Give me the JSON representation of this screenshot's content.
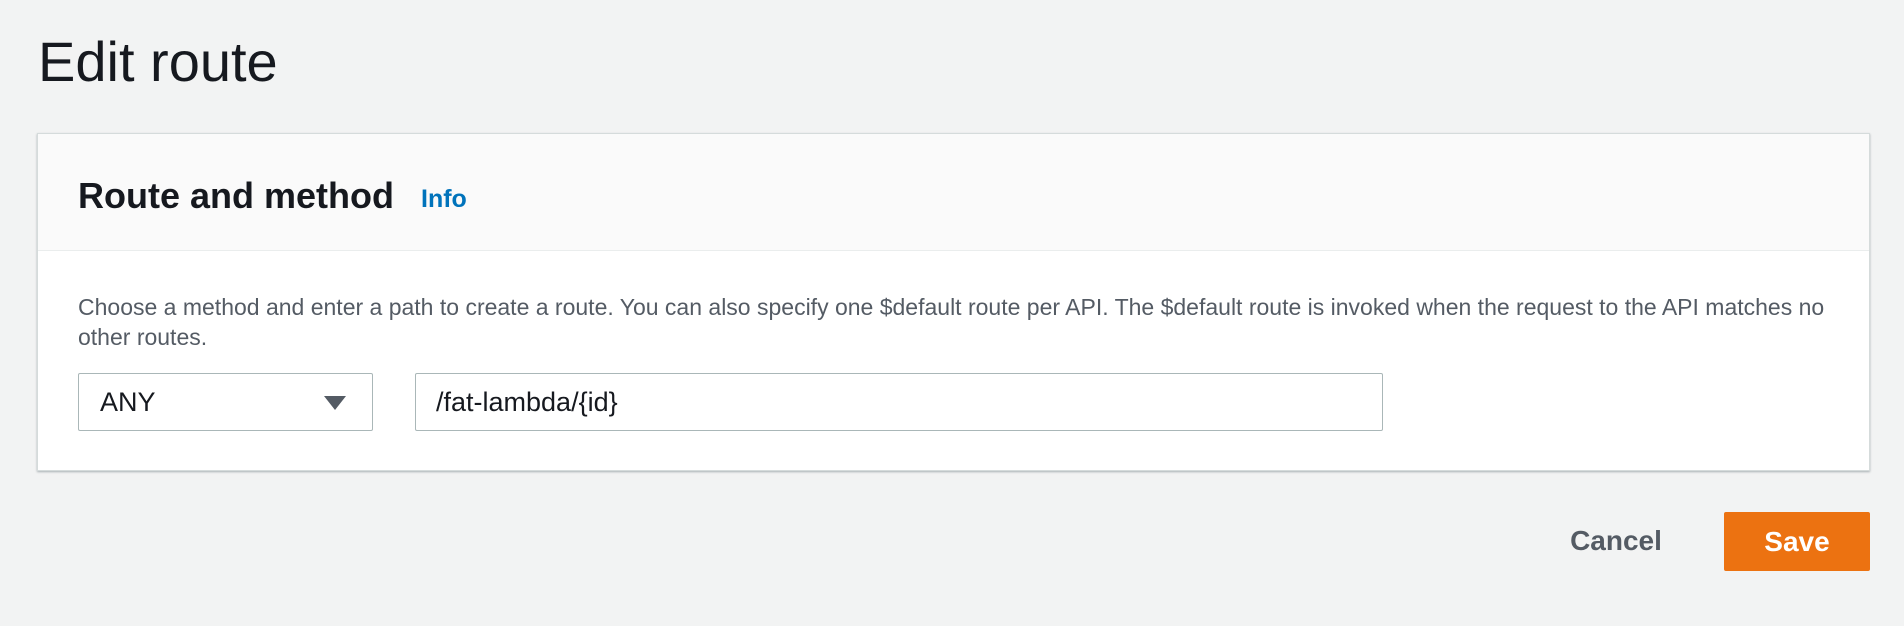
{
  "page": {
    "title": "Edit route"
  },
  "panel": {
    "title": "Route and method",
    "info_link": "Info",
    "description": "Choose a method and enter a path to create a route. You can also specify one $default route per API. The $default route is invoked when the request to the API matches no other routes."
  },
  "form": {
    "method": {
      "selected": "ANY"
    },
    "path": {
      "value": "/fat-lambda/{id}"
    }
  },
  "actions": {
    "cancel_label": "Cancel",
    "save_label": "Save"
  },
  "colors": {
    "background": "#f2f3f3",
    "link": "#0073bb",
    "primary_button": "#ec7211",
    "secondary_text": "#545b64"
  },
  "icons": {
    "method_dropdown": "caret-down-icon"
  }
}
